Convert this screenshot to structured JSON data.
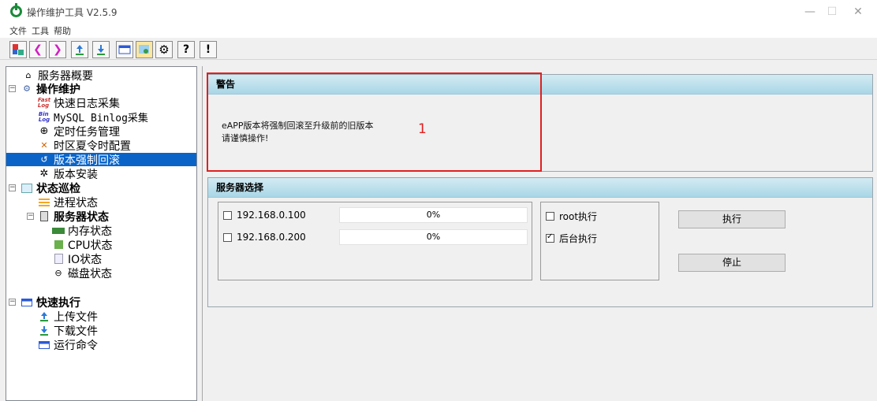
{
  "window": {
    "title": "操作维护工具 V2.5.9",
    "controls": [
      "—",
      "☐",
      "✕"
    ]
  },
  "menu": [
    "文件",
    "工具",
    "帮助"
  ],
  "toolbar": {
    "buttons": [
      "tree-icon",
      "arrow-left-icon",
      "arrow-right-icon",
      "upload-icon",
      "download-icon",
      "command-icon",
      "image-icon",
      "settings-icon",
      "?",
      "!"
    ]
  },
  "tree": {
    "items": [
      {
        "label": "服务器概要",
        "icon": "home-icon"
      },
      {
        "label": "操作维护",
        "icon": "gear-icon",
        "bold": true,
        "expander": "⊟"
      },
      {
        "label": "快速日志采集",
        "icon": "fastlog-icon"
      },
      {
        "label": "MySQL Binlog采集",
        "icon": "binlog-icon"
      },
      {
        "label": "定时任务管理",
        "icon": "clock-icon"
      },
      {
        "label": "时区夏令时配置",
        "icon": "tools-icon"
      },
      {
        "label": "版本强制回滚",
        "icon": "rollback-icon",
        "selected": true
      },
      {
        "label": "版本安装",
        "icon": "install-icon"
      },
      {
        "label": "状态巡检",
        "icon": "inspect-icon",
        "bold": true,
        "expander": "⊟"
      },
      {
        "label": "进程状态",
        "icon": "process-icon"
      },
      {
        "label": "服务器状态",
        "icon": "server-icon",
        "bold": true,
        "expander": "⊟"
      },
      {
        "label": "内存状态",
        "icon": "memory-icon"
      },
      {
        "label": "CPU状态",
        "icon": "cpu-icon"
      },
      {
        "label": "IO状态",
        "icon": "io-icon"
      },
      {
        "label": "磁盘状态",
        "icon": "disk-icon"
      },
      {
        "label": "快速执行",
        "icon": "exec-icon",
        "bold": true,
        "expander": "⊟"
      },
      {
        "label": "上传文件",
        "icon": "upload-icon"
      },
      {
        "label": "下载文件",
        "icon": "download-icon"
      },
      {
        "label": "运行命令",
        "icon": "command-icon"
      }
    ]
  },
  "warning": {
    "header": "警告",
    "line1": "eAPP版本将强制回滚至升级前的旧版本",
    "line2": "请谨慎操作!",
    "annotation": "1"
  },
  "server_select": {
    "header": "服务器选择",
    "servers": [
      {
        "ip": "192.168.0.100",
        "progress": "0%",
        "checked": false
      },
      {
        "ip": "192.168.0.200",
        "progress": "0%",
        "checked": false
      }
    ],
    "options": [
      {
        "label": "root执行",
        "checked": false
      },
      {
        "label": "后台执行",
        "checked": true
      }
    ],
    "execute_label": "执行",
    "stop_label": "停止"
  }
}
